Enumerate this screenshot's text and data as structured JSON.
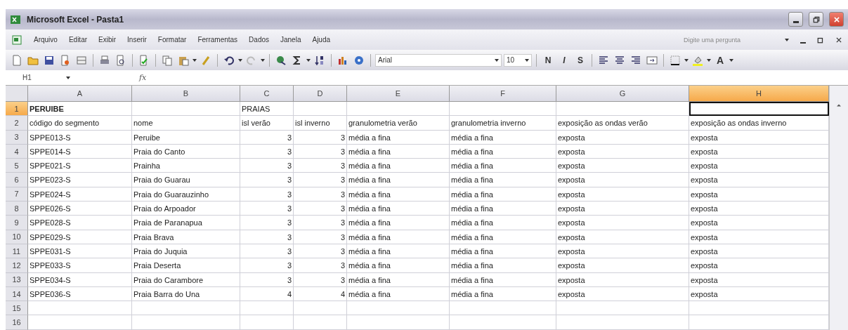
{
  "window": {
    "title": "Microsoft Excel - Pasta1"
  },
  "menu": [
    "Arquivo",
    "Editar",
    "Exibir",
    "Inserir",
    "Formatar",
    "Ferramentas",
    "Dados",
    "Janela",
    "Ajuda"
  ],
  "help_box": {
    "placeholder": "Digite uma pergunta"
  },
  "formatting": {
    "font": "Arial",
    "size": "10",
    "bold": "N",
    "italic": "I",
    "underline": "S",
    "font_color": "A"
  },
  "formula_bar": {
    "name_box": "H1",
    "fx": "fx"
  },
  "columns": [
    {
      "label": "A",
      "selected": false
    },
    {
      "label": "B",
      "selected": false
    },
    {
      "label": "C",
      "selected": false
    },
    {
      "label": "D",
      "selected": false
    },
    {
      "label": "E",
      "selected": false
    },
    {
      "label": "F",
      "selected": false
    },
    {
      "label": "G",
      "selected": false
    },
    {
      "label": "H",
      "selected": true
    }
  ],
  "rows": [
    {
      "number": "1",
      "selected": true,
      "cells": [
        {
          "kind": "text",
          "text": "PERUIBE",
          "bold": true
        },
        {
          "kind": "empty"
        },
        {
          "kind": "text",
          "text": "PRAIAS"
        },
        {
          "kind": "empty"
        },
        {
          "kind": "empty"
        },
        {
          "kind": "empty"
        },
        {
          "kind": "empty"
        },
        {
          "kind": "empty"
        }
      ]
    },
    {
      "number": "2",
      "selected": false,
      "cells": [
        {
          "kind": "text",
          "text": "código do segmento"
        },
        {
          "kind": "text",
          "text": "nome"
        },
        {
          "kind": "text",
          "text": "isl  verão"
        },
        {
          "kind": "text",
          "text": "isl inverno"
        },
        {
          "kind": "text",
          "text": "granulometria  verão"
        },
        {
          "kind": "text",
          "text": "granulometria inverno"
        },
        {
          "kind": "text",
          "text": "exposição as ondas  verão"
        },
        {
          "kind": "text",
          "text": "exposição as ondas inverno"
        }
      ]
    },
    {
      "number": "3",
      "selected": false,
      "cells": [
        {
          "kind": "text",
          "text": "SPPE013-S"
        },
        {
          "kind": "text",
          "text": "Peruibe"
        },
        {
          "kind": "number",
          "text": "3"
        },
        {
          "kind": "number",
          "text": "3"
        },
        {
          "kind": "text",
          "text": "média a fina"
        },
        {
          "kind": "text",
          "text": "média a fina"
        },
        {
          "kind": "text",
          "text": "exposta"
        },
        {
          "kind": "text",
          "text": "exposta"
        }
      ]
    },
    {
      "number": "4",
      "selected": false,
      "cells": [
        {
          "kind": "text",
          "text": "SPPE014-S"
        },
        {
          "kind": "text",
          "text": "Praia do Canto"
        },
        {
          "kind": "number",
          "text": "3"
        },
        {
          "kind": "number",
          "text": "3"
        },
        {
          "kind": "text",
          "text": "média a fina"
        },
        {
          "kind": "text",
          "text": "média a fina"
        },
        {
          "kind": "text",
          "text": "exposta"
        },
        {
          "kind": "text",
          "text": "exposta"
        }
      ]
    },
    {
      "number": "5",
      "selected": false,
      "cells": [
        {
          "kind": "text",
          "text": "SPPE021-S"
        },
        {
          "kind": "text",
          "text": "Prainha"
        },
        {
          "kind": "number",
          "text": "3"
        },
        {
          "kind": "number",
          "text": "3"
        },
        {
          "kind": "text",
          "text": "média a fina"
        },
        {
          "kind": "text",
          "text": "média a fina"
        },
        {
          "kind": "text",
          "text": "exposta"
        },
        {
          "kind": "text",
          "text": "exposta"
        }
      ]
    },
    {
      "number": "6",
      "selected": false,
      "cells": [
        {
          "kind": "text",
          "text": "SPPE023-S"
        },
        {
          "kind": "text",
          "text": "Praia do Guarau"
        },
        {
          "kind": "number",
          "text": "3"
        },
        {
          "kind": "number",
          "text": "3"
        },
        {
          "kind": "text",
          "text": "média a fina"
        },
        {
          "kind": "text",
          "text": "média a fina"
        },
        {
          "kind": "text",
          "text": "exposta"
        },
        {
          "kind": "text",
          "text": "exposta"
        }
      ]
    },
    {
      "number": "7",
      "selected": false,
      "cells": [
        {
          "kind": "text",
          "text": "SPPE024-S"
        },
        {
          "kind": "text",
          "text": "Praia do Guarauzinho"
        },
        {
          "kind": "number",
          "text": "3"
        },
        {
          "kind": "number",
          "text": "3"
        },
        {
          "kind": "text",
          "text": "média a fina"
        },
        {
          "kind": "text",
          "text": "média a fina"
        },
        {
          "kind": "text",
          "text": "exposta"
        },
        {
          "kind": "text",
          "text": "exposta"
        }
      ]
    },
    {
      "number": "8",
      "selected": false,
      "cells": [
        {
          "kind": "text",
          "text": "SPPE026-S"
        },
        {
          "kind": "text",
          "text": "Praia do Arpoador"
        },
        {
          "kind": "number",
          "text": "3"
        },
        {
          "kind": "number",
          "text": "3"
        },
        {
          "kind": "text",
          "text": "média a fina"
        },
        {
          "kind": "text",
          "text": "média a fina"
        },
        {
          "kind": "text",
          "text": "exposta"
        },
        {
          "kind": "text",
          "text": "exposta"
        }
      ]
    },
    {
      "number": "9",
      "selected": false,
      "cells": [
        {
          "kind": "text",
          "text": "SPPE028-S"
        },
        {
          "kind": "text",
          "text": "Praia de Paranapua"
        },
        {
          "kind": "number",
          "text": "3"
        },
        {
          "kind": "number",
          "text": "3"
        },
        {
          "kind": "text",
          "text": "média a fina"
        },
        {
          "kind": "text",
          "text": "média a fina"
        },
        {
          "kind": "text",
          "text": "exposta"
        },
        {
          "kind": "text",
          "text": "exposta"
        }
      ]
    },
    {
      "number": "10",
      "selected": false,
      "cells": [
        {
          "kind": "text",
          "text": "SPPE029-S"
        },
        {
          "kind": "text",
          "text": "Praia Brava"
        },
        {
          "kind": "number",
          "text": "3"
        },
        {
          "kind": "number",
          "text": "3"
        },
        {
          "kind": "text",
          "text": "média a fina"
        },
        {
          "kind": "text",
          "text": "média a fina"
        },
        {
          "kind": "text",
          "text": "exposta"
        },
        {
          "kind": "text",
          "text": "exposta"
        }
      ]
    },
    {
      "number": "11",
      "selected": false,
      "cells": [
        {
          "kind": "text",
          "text": "SPPE031-S"
        },
        {
          "kind": "text",
          "text": "Praia do Juquia"
        },
        {
          "kind": "number",
          "text": "3"
        },
        {
          "kind": "number",
          "text": "3"
        },
        {
          "kind": "text",
          "text": "média a fina"
        },
        {
          "kind": "text",
          "text": "média a fina"
        },
        {
          "kind": "text",
          "text": "exposta"
        },
        {
          "kind": "text",
          "text": "exposta"
        }
      ]
    },
    {
      "number": "12",
      "selected": false,
      "cells": [
        {
          "kind": "text",
          "text": "SPPE033-S"
        },
        {
          "kind": "text",
          "text": "Praia Deserta"
        },
        {
          "kind": "number",
          "text": "3"
        },
        {
          "kind": "number",
          "text": "3"
        },
        {
          "kind": "text",
          "text": "média a fina"
        },
        {
          "kind": "text",
          "text": "média a fina"
        },
        {
          "kind": "text",
          "text": "exposta"
        },
        {
          "kind": "text",
          "text": "exposta"
        }
      ]
    },
    {
      "number": "13",
      "selected": false,
      "cells": [
        {
          "kind": "text",
          "text": "SPPE034-S"
        },
        {
          "kind": "text",
          "text": "Praia do Carambore"
        },
        {
          "kind": "number",
          "text": "3"
        },
        {
          "kind": "number",
          "text": "3"
        },
        {
          "kind": "text",
          "text": "média a fina"
        },
        {
          "kind": "text",
          "text": "média a fina"
        },
        {
          "kind": "text",
          "text": "exposta"
        },
        {
          "kind": "text",
          "text": "exposta"
        }
      ]
    },
    {
      "number": "14",
      "selected": false,
      "cells": [
        {
          "kind": "text",
          "text": "SPPE036-S"
        },
        {
          "kind": "text",
          "text": "Praia Barra do Una"
        },
        {
          "kind": "number",
          "text": "4"
        },
        {
          "kind": "number",
          "text": "4"
        },
        {
          "kind": "text",
          "text": "média a fina"
        },
        {
          "kind": "text",
          "text": "média a fina"
        },
        {
          "kind": "text",
          "text": "exposta"
        },
        {
          "kind": "text",
          "text": "exposta"
        }
      ]
    },
    {
      "number": "15",
      "selected": false
    },
    {
      "number": "16",
      "selected": false
    }
  ]
}
